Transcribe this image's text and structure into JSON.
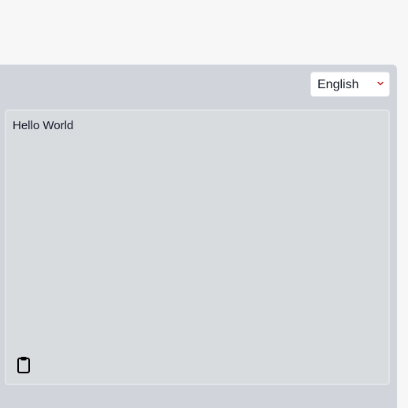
{
  "language_select": {
    "selected": "English",
    "options": [
      "English"
    ]
  },
  "translation": {
    "text": "Hello World"
  },
  "icons": {
    "copy": "clipboard-icon",
    "dropdown": "chevron-down-icon"
  },
  "colors": {
    "panel_bg": "#d1d5db",
    "textbox_bg": "#d9dcdf",
    "chevron": "#b91c1c"
  }
}
